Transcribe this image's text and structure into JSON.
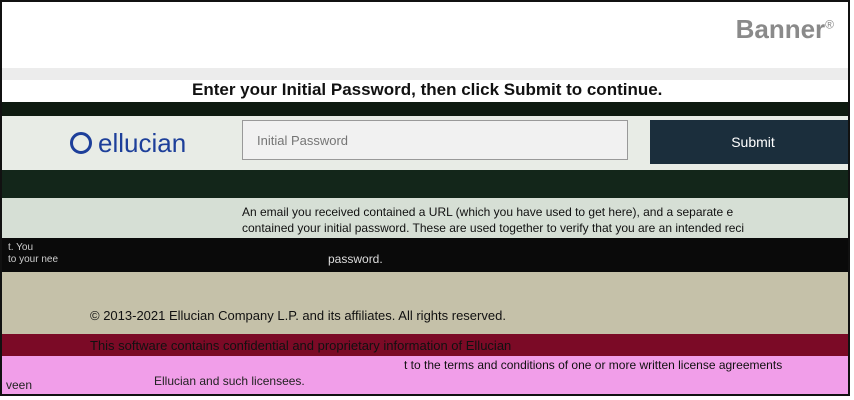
{
  "brand": {
    "banner_logo": "Banner",
    "banner_mark": "®",
    "ellucian": "ellucian"
  },
  "prompt": "Enter your Initial Password, then click Submit to continue.",
  "form": {
    "password_placeholder": "Initial Password",
    "submit_label": "Submit"
  },
  "info": {
    "line1": "An email you received contained a URL (which you have used to get here), and a separate e",
    "line2": "contained your initial password. These are used together to verify that you are an intended reci",
    "password_word": "password."
  },
  "side_label": {
    "line1": "t. You",
    "line2": "to your nee"
  },
  "footer": {
    "copyright": "© 2013-2021 Ellucian Company L.P. and its affiliates. All rights reserved.",
    "confidential": "This software contains confidential and proprietary information of Ellucian",
    "confidential_tail": "t to the terms and conditions of one or more written license agreements",
    "licensees": "Ellucian and such licensees.",
    "ween": "veen"
  }
}
